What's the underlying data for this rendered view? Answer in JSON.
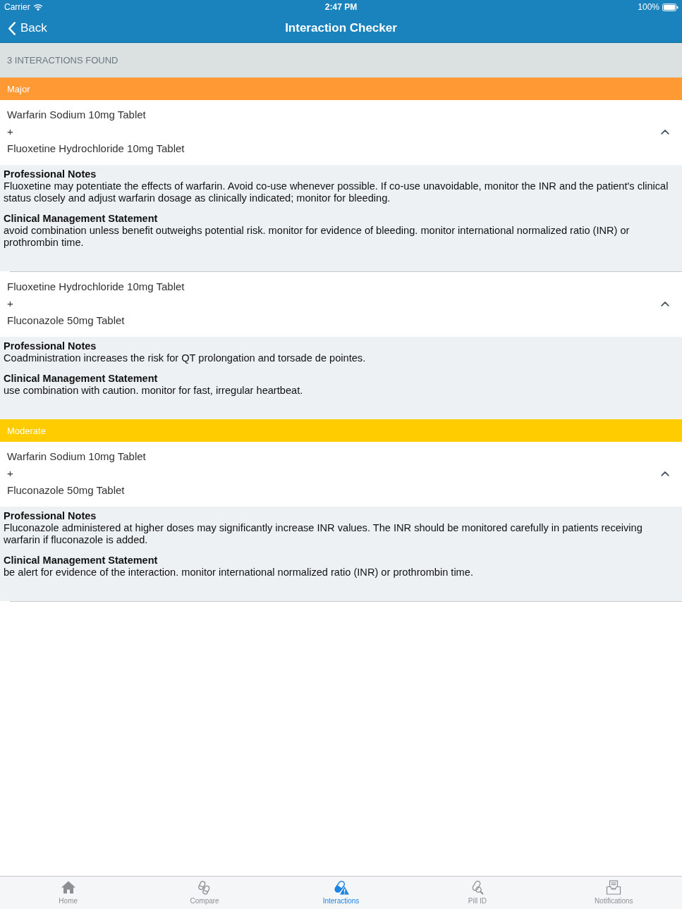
{
  "status_bar": {
    "carrier": "Carrier",
    "time": "2:47 PM",
    "battery": "100%"
  },
  "nav_bar": {
    "back": "Back",
    "title": "Interaction Checker"
  },
  "summary": "3 INTERACTIONS FOUND",
  "groups": [
    {
      "severity": "Major",
      "color": "#ff9933",
      "interactions": [
        {
          "drugs": [
            "Warfarin Sodium 10mg Tablet",
            "Fluoxetine Hydrochloride 10mg Tablet"
          ],
          "connector": "+",
          "expanded": true,
          "sections": [
            {
              "heading": "Professional Notes",
              "text": "Fluoxetine may potentiate the effects of warfarin. Avoid co-use whenever possible. If co-use unavoidable, monitor the INR and the patient's clinical status closely and adjust warfarin dosage as clinically indicated; monitor for bleeding."
            },
            {
              "heading": "Clinical Management Statement",
              "text": "avoid combination unless benefit outweighs potential risk. monitor for evidence of bleeding. monitor international normalized ratio (INR) or prothrombin time."
            }
          ]
        },
        {
          "drugs": [
            "Fluoxetine Hydrochloride 10mg Tablet",
            "Fluconazole 50mg Tablet"
          ],
          "connector": "+",
          "expanded": true,
          "sections": [
            {
              "heading": "Professional Notes",
              "text": "Coadministration increases the risk for QT prolongation and torsade de pointes."
            },
            {
              "heading": "Clinical Management Statement",
              "text": "use combination with caution. monitor for fast, irregular heartbeat."
            }
          ]
        }
      ]
    },
    {
      "severity": "Moderate",
      "color": "#ffcc00",
      "interactions": [
        {
          "drugs": [
            "Warfarin Sodium 10mg Tablet",
            "Fluconazole 50mg Tablet"
          ],
          "connector": "+",
          "expanded": true,
          "sections": [
            {
              "heading": "Professional Notes",
              "text": "Fluconazole administered at higher doses may significantly increase INR values. The INR should be monitored carefully in patients receiving warfarin if fluconazole is added."
            },
            {
              "heading": "Clinical Management Statement",
              "text": "be alert for evidence of the interaction. monitor international normalized ratio (INR) or prothrombin time."
            }
          ]
        }
      ]
    }
  ],
  "tab_bar": {
    "items": [
      {
        "kind": "home",
        "label": "Home",
        "selected": false
      },
      {
        "kind": "compare",
        "label": "Compare",
        "selected": false
      },
      {
        "kind": "interactions",
        "label": "Interactions",
        "selected": true
      },
      {
        "kind": "pillid",
        "label": "Pill ID",
        "selected": false
      },
      {
        "kind": "notifications",
        "label": "Notifications",
        "selected": false
      }
    ]
  }
}
